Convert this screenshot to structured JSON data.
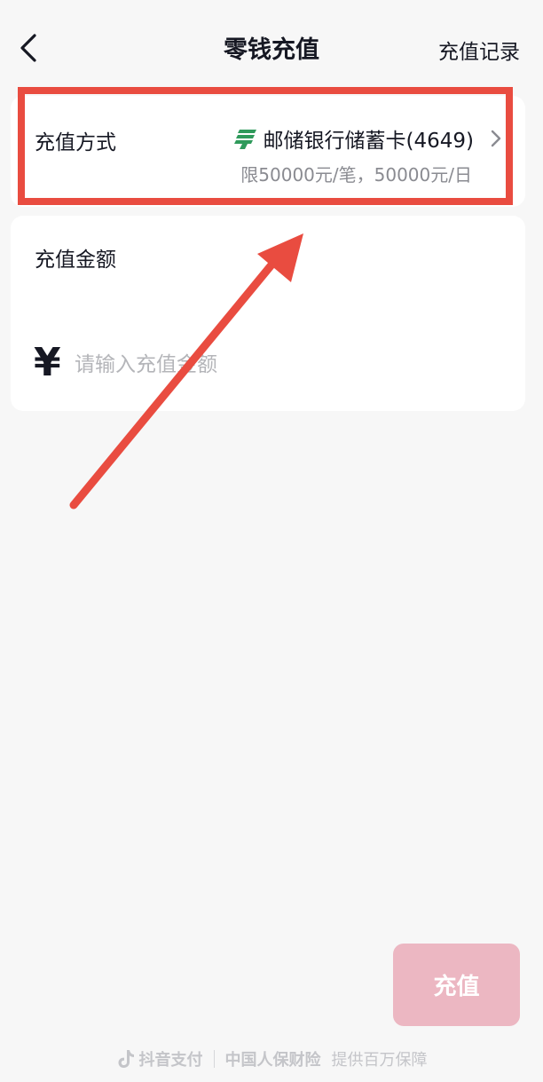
{
  "nav": {
    "title": "零钱充值",
    "right_link": "充值记录"
  },
  "payment_method": {
    "label": "充值方式",
    "bank_name": "邮储银行储蓄卡(4649)",
    "limit": "限50000元/笔，50000元/日",
    "bank_logo_color": "#2f9a5b"
  },
  "amount": {
    "label": "充值金额",
    "currency_symbol": "¥",
    "placeholder": "请输入充值金额",
    "value": ""
  },
  "submit": {
    "label": "充值",
    "color": "#ecb7c2"
  },
  "footer": {
    "pay_brand": "抖音支付",
    "insurer": "中国人保财险",
    "guarantee": "提供百万保障"
  },
  "annotation": {
    "highlight_color": "#e94c40"
  }
}
